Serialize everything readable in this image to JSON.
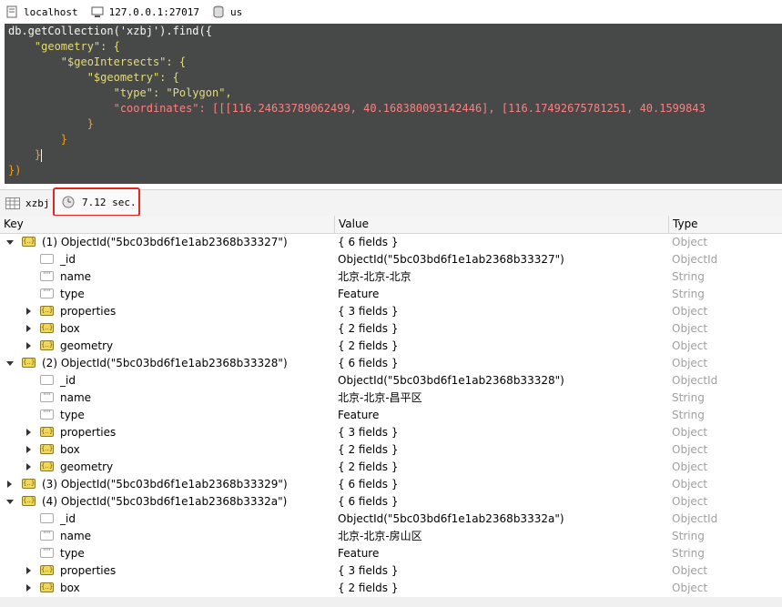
{
  "connection": {
    "host": "localhost",
    "address": "127.0.0.1:27017",
    "database": "us"
  },
  "editor": {
    "lines": [
      "db.getCollection('xzbj').find({",
      "    \"geometry\": {",
      "        \"$geoIntersects\": {",
      "            \"$geometry\": {",
      "                \"type\": \"Polygon\",",
      "                \"coordinates\": [[[116.24633789062499, 40.168380093142446], [116.17492675781251, 40.1599843",
      "            }",
      "        }",
      "    }",
      "})"
    ]
  },
  "result_tab": {
    "collection": "xzbj",
    "elapsed": "7.12 sec."
  },
  "columns": {
    "key": "Key",
    "value": "Value",
    "type": "Type"
  },
  "rows": [
    {
      "key": "(1) ObjectId(\"5bc03bd6f1e1ab2368b33327\")",
      "value": "{ 6 fields }",
      "type": "Object"
    },
    {
      "key": "_id",
      "value": "ObjectId(\"5bc03bd6f1e1ab2368b33327\")",
      "type": "ObjectId"
    },
    {
      "key": "name",
      "value": "北京-北京-北京",
      "type": "String"
    },
    {
      "key": "type",
      "value": "Feature",
      "type": "String"
    },
    {
      "key": "properties",
      "value": "{ 3 fields }",
      "type": "Object"
    },
    {
      "key": "box",
      "value": "{ 2 fields }",
      "type": "Object"
    },
    {
      "key": "geometry",
      "value": "{ 2 fields }",
      "type": "Object"
    },
    {
      "key": "(2) ObjectId(\"5bc03bd6f1e1ab2368b33328\")",
      "value": "{ 6 fields }",
      "type": "Object"
    },
    {
      "key": "_id",
      "value": "ObjectId(\"5bc03bd6f1e1ab2368b33328\")",
      "type": "ObjectId"
    },
    {
      "key": "name",
      "value": "北京-北京-昌平区",
      "type": "String"
    },
    {
      "key": "type",
      "value": "Feature",
      "type": "String"
    },
    {
      "key": "properties",
      "value": "{ 3 fields }",
      "type": "Object"
    },
    {
      "key": "box",
      "value": "{ 2 fields }",
      "type": "Object"
    },
    {
      "key": "geometry",
      "value": "{ 2 fields }",
      "type": "Object"
    },
    {
      "key": "(3) ObjectId(\"5bc03bd6f1e1ab2368b33329\")",
      "value": "{ 6 fields }",
      "type": "Object"
    },
    {
      "key": "(4) ObjectId(\"5bc03bd6f1e1ab2368b3332a\")",
      "value": "{ 6 fields }",
      "type": "Object"
    },
    {
      "key": "_id",
      "value": "ObjectId(\"5bc03bd6f1e1ab2368b3332a\")",
      "type": "ObjectId"
    },
    {
      "key": "name",
      "value": "北京-北京-房山区",
      "type": "String"
    },
    {
      "key": "type",
      "value": "Feature",
      "type": "String"
    },
    {
      "key": "properties",
      "value": "{ 3 fields }",
      "type": "Object"
    },
    {
      "key": "box",
      "value": "{ 2 fields }",
      "type": "Object"
    }
  ]
}
